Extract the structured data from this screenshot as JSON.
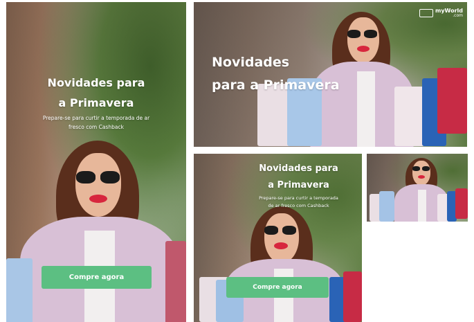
{
  "banners": {
    "tall": {
      "headline_line1": "Novidades para",
      "headline_line2": "a Primavera",
      "subtext_line1": "Prepare-se para curtir a temporada de ar",
      "subtext_line2": "fresco com Cashback",
      "cta_label": "Compre agora"
    },
    "wide": {
      "headline_line1": "Novidades",
      "headline_line2": "para a Primavera",
      "logo_text": "myWorld",
      "logo_subtext": ".com"
    },
    "medium": {
      "headline_line1": "Novidades para",
      "headline_line2": "a Primavera",
      "subtext_line1": "Prepare-se para curtir a temporada",
      "subtext_line2": "de ar fresco com Cashback",
      "cta_label": "Compre agora"
    },
    "small": {}
  },
  "colors": {
    "cta_green": "#5cbf82",
    "text_white": "#ffffff",
    "page_background": "#ffffff"
  }
}
